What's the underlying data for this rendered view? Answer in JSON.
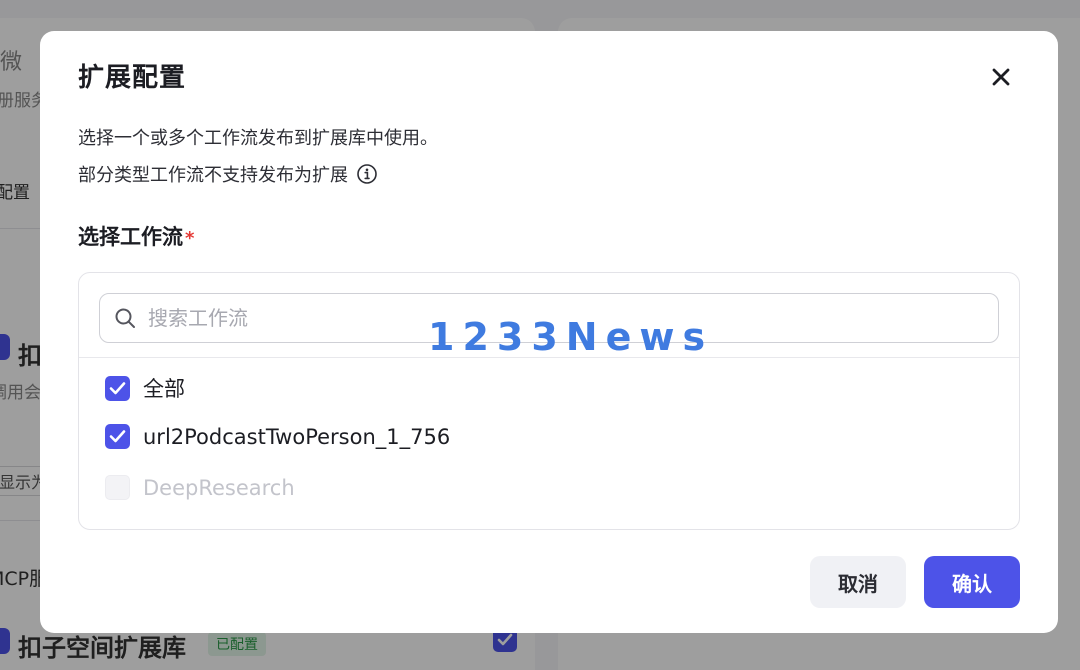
{
  "background": {
    "left_items": [
      "微",
      "注册服务",
      "配置",
      "扣",
      "调用会出",
      "显示为",
      "MCP服务",
      "扣子空间扩展库"
    ],
    "badge": "已配置"
  },
  "modal": {
    "title": "扩展配置",
    "description_1": "选择一个或多个工作流发布到扩展库中使用。",
    "description_2": "部分类型工作流不支持发布为扩展",
    "field_label": "选择工作流",
    "required_mark": "*",
    "search": {
      "placeholder": "搜索工作流",
      "value": ""
    },
    "options": [
      {
        "label": "全部",
        "checked": true,
        "disabled": false
      },
      {
        "label": "url2PodcastTwoPerson_1_756",
        "checked": true,
        "disabled": false
      },
      {
        "label": "DeepResearch",
        "checked": false,
        "disabled": true
      }
    ],
    "cancel_label": "取消",
    "confirm_label": "确认"
  },
  "watermark": "1233News",
  "colors": {
    "accent": "#4d53e8",
    "required": "#e53935",
    "watermark": "#3f7be0"
  },
  "icons": {
    "close": "close-icon",
    "info": "info-icon",
    "search": "search-icon",
    "check": "check-icon"
  }
}
